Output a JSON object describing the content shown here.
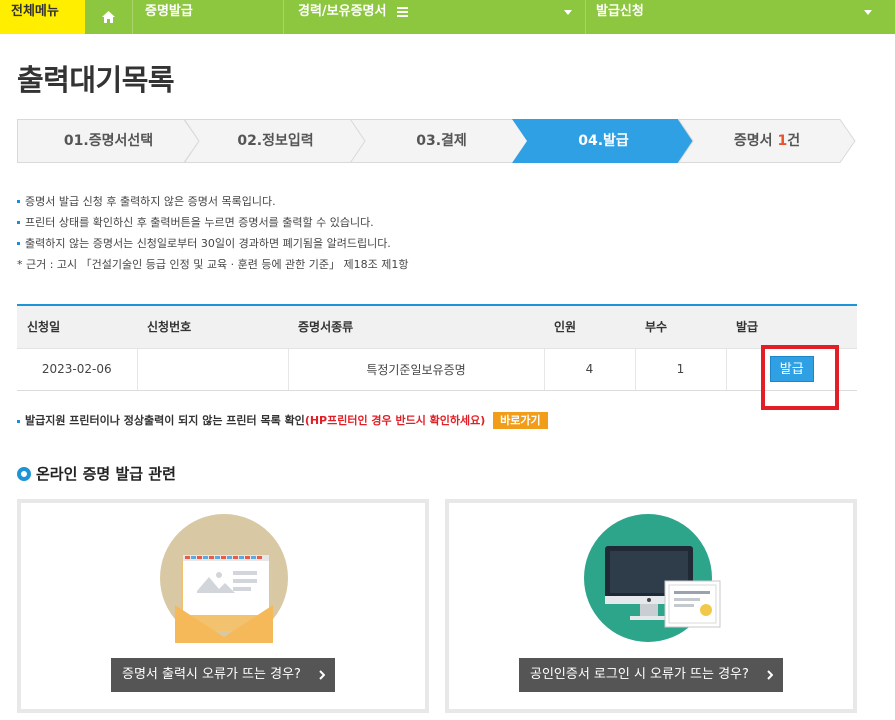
{
  "nav": {
    "all_menu": "전체메뉴",
    "certificate": "증명발급",
    "career": "경력/보유증명서",
    "apply": "발급신청"
  },
  "page_title": "출력대기목록",
  "steps": [
    {
      "label": "01.증명서선택"
    },
    {
      "label": "02.정보입력"
    },
    {
      "label": "03.결제"
    },
    {
      "label": "04.발급"
    },
    {
      "label_prefix": "증명서 ",
      "count": "1",
      "label_suffix": "건"
    }
  ],
  "notes": [
    "증명서 발급 신청 후 출력하지 않은 증명서 목록입니다.",
    "프린터 상태를 확인하신 후 출력버튼을 누르면 증명서를 출력할 수 있습니다.",
    "출력하지 않는 증명서는 신청일로부터 30일이 경과하면 폐기됨을 알려드립니다.",
    "* 근거 : 고시 「건설기술인 등급 인정 및 교육 · 훈련 등에 관한 기준」 제18조 제1항"
  ],
  "table": {
    "headers": [
      "신청일",
      "신청번호",
      "증명서종류",
      "인원",
      "부수",
      "발급"
    ],
    "rows": [
      {
        "date": "2023-02-06",
        "number": "",
        "type": "특정기준일보유증명",
        "people": "4",
        "copies": "1",
        "action": "발급"
      }
    ]
  },
  "printer_note": {
    "text": "발급지원 프린터이나 정상출력이 되지 않는 프린터 목록 확인",
    "warning": "(HP프린터인 경우 반드시 확인하세요)",
    "button": "바로가기"
  },
  "section_title": "온라인 증명 발급 관련",
  "cards": [
    {
      "button": "증명서 출력시 오류가 뜨는 경우?"
    },
    {
      "button": "공인인증서 로그인 시 오류가 뜨는 경우?"
    }
  ],
  "colors": {
    "nav_green": "#8dc63f",
    "active_step": "#2fa0e4",
    "highlight_red": "#e21f26"
  }
}
